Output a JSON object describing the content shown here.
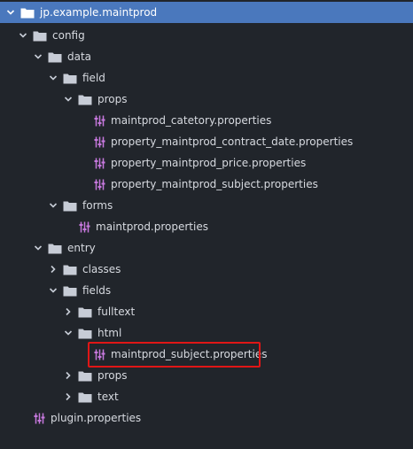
{
  "colors": {
    "background": "#21252b",
    "selected_row": "#4a78bd",
    "folder_icon": "#c7ccd6",
    "properties_icon": "#c678dd",
    "highlight_box": "#e01616"
  },
  "tree": [
    {
      "label": "jp.example.maintprod",
      "kind": "folder",
      "state": "expanded",
      "selected": true
    },
    {
      "label": "config",
      "kind": "folder",
      "state": "expanded"
    },
    {
      "label": "data",
      "kind": "folder",
      "state": "expanded"
    },
    {
      "label": "field",
      "kind": "folder",
      "state": "expanded"
    },
    {
      "label": "props",
      "kind": "folder",
      "state": "expanded"
    },
    {
      "label": "maintprod_catetory.properties",
      "kind": "file",
      "icon": "properties-file-icon"
    },
    {
      "label": "property_maintprod_contract_date.properties",
      "kind": "file",
      "icon": "properties-file-icon"
    },
    {
      "label": "property_maintprod_price.properties",
      "kind": "file",
      "icon": "properties-file-icon"
    },
    {
      "label": "property_maintprod_subject.properties",
      "kind": "file",
      "icon": "properties-file-icon"
    },
    {
      "label": "forms",
      "kind": "folder",
      "state": "expanded"
    },
    {
      "label": "maintprod.properties",
      "kind": "file",
      "icon": "properties-file-icon"
    },
    {
      "label": "entry",
      "kind": "folder",
      "state": "expanded"
    },
    {
      "label": "classes",
      "kind": "folder",
      "state": "collapsed"
    },
    {
      "label": "fields",
      "kind": "folder",
      "state": "expanded"
    },
    {
      "label": "fulltext",
      "kind": "folder",
      "state": "collapsed"
    },
    {
      "label": "html",
      "kind": "folder",
      "state": "expanded"
    },
    {
      "label": "maintprod_subject.properties",
      "kind": "file",
      "icon": "properties-file-icon",
      "highlighted": true
    },
    {
      "label": "props",
      "kind": "folder",
      "state": "collapsed"
    },
    {
      "label": "text",
      "kind": "folder",
      "state": "collapsed"
    },
    {
      "label": "plugin.properties",
      "kind": "file",
      "icon": "properties-file-icon"
    }
  ]
}
